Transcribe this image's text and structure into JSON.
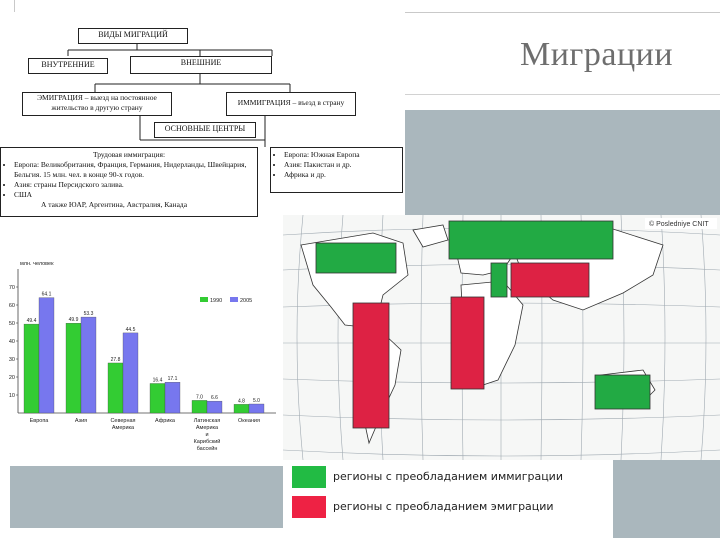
{
  "slide": {
    "title": "Миграции",
    "accent_slate": "#aab7bd"
  },
  "diagram": {
    "root": "ВИДЫ МИГРАЦИЙ",
    "internal": "ВНУТРЕННИЕ",
    "external": "ВНЕШНИЕ",
    "emigration": "ЭМИГРАЦИЯ – выезд на постоянное жительство в другую страну",
    "immigration": "ИММИГРАЦИЯ – въезд в страну",
    "centers": "ОСНОВНЫЕ ЦЕНТРЫ",
    "left_heading": "Трудовая иммиграция:",
    "left_items": [
      "Европа: Великобритания, Франция, Германия, Нидерланды, Швейцария, Бельгия. 15 млн. чел. в конце 90-х годов.",
      "Азия: страны Персидского залива.",
      "США"
    ],
    "left_footer": "А также ЮАР, Аргентина, Австралия, Канада",
    "right_items": [
      "Европа: Южная Европа",
      "Азия: Пакистан и др.",
      "Африка и др."
    ]
  },
  "chart_data": {
    "type": "bar",
    "ylabel": "млн. человек",
    "ylim": [
      0,
      80
    ],
    "yticks": [
      10,
      20,
      30,
      40,
      50,
      60,
      70
    ],
    "categories": [
      "Европа",
      "Азия",
      "Северная Америка",
      "Африка",
      "Латинская Америка и Карибский бассейн",
      "Океания"
    ],
    "series": [
      {
        "name": "1990",
        "values": [
          49.4,
          49.9,
          27.8,
          16.4,
          7.0,
          4.8
        ],
        "color": "#33cc33"
      },
      {
        "name": "2005",
        "values": [
          64.1,
          53.3,
          44.5,
          17.1,
          6.6,
          5.0
        ],
        "color": "#7777ee"
      }
    ],
    "value_labels_1990": [
      "49.4",
      "49.9",
      "27.8",
      "16.4",
      "7.0",
      "4.8"
    ],
    "value_labels_2005": [
      "64.1",
      "53.3",
      "44.5",
      "17.1",
      "6.6",
      "5.0"
    ],
    "legend": "top-right",
    "grid": false
  },
  "map": {
    "credit": "© Posledniye CNIT",
    "immigration_color": "#22aa44",
    "emigration_color": "#dd2244"
  },
  "legend": {
    "immigration": "регионы с преобладанием иммиграции",
    "emigration": "регионы с преобладанием эмиграции"
  }
}
